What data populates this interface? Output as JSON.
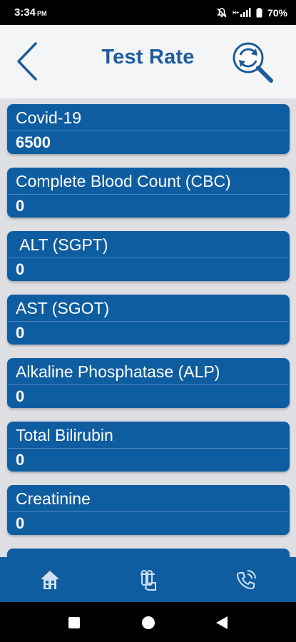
{
  "status_bar": {
    "time": "3:34",
    "ampm": "PM",
    "battery": "70%"
  },
  "header": {
    "title": "Test Rate"
  },
  "tests": [
    {
      "name": "Covid-19",
      "rate": "6500"
    },
    {
      "name": "Complete Blood Count (CBC)",
      "rate": "0"
    },
    {
      "name": " ALT (SGPT)",
      "rate": "0"
    },
    {
      "name": "AST (SGOT)",
      "rate": "0"
    },
    {
      "name": "Alkaline Phosphatase (ALP)",
      "rate": "0"
    },
    {
      "name": "Total Bilirubin",
      "rate": "0"
    },
    {
      "name": "Creatinine",
      "rate": "0"
    },
    {
      "name": "",
      "rate": ""
    }
  ],
  "icons": {
    "back": "chevron-left-icon",
    "search": "search-refresh-icon",
    "home": "home-icon",
    "tests": "test-tubes-icon",
    "call": "phone-call-icon"
  },
  "colors": {
    "primary": "#0f5da1",
    "title": "#1c5c9b",
    "background": "#dedfe3"
  }
}
